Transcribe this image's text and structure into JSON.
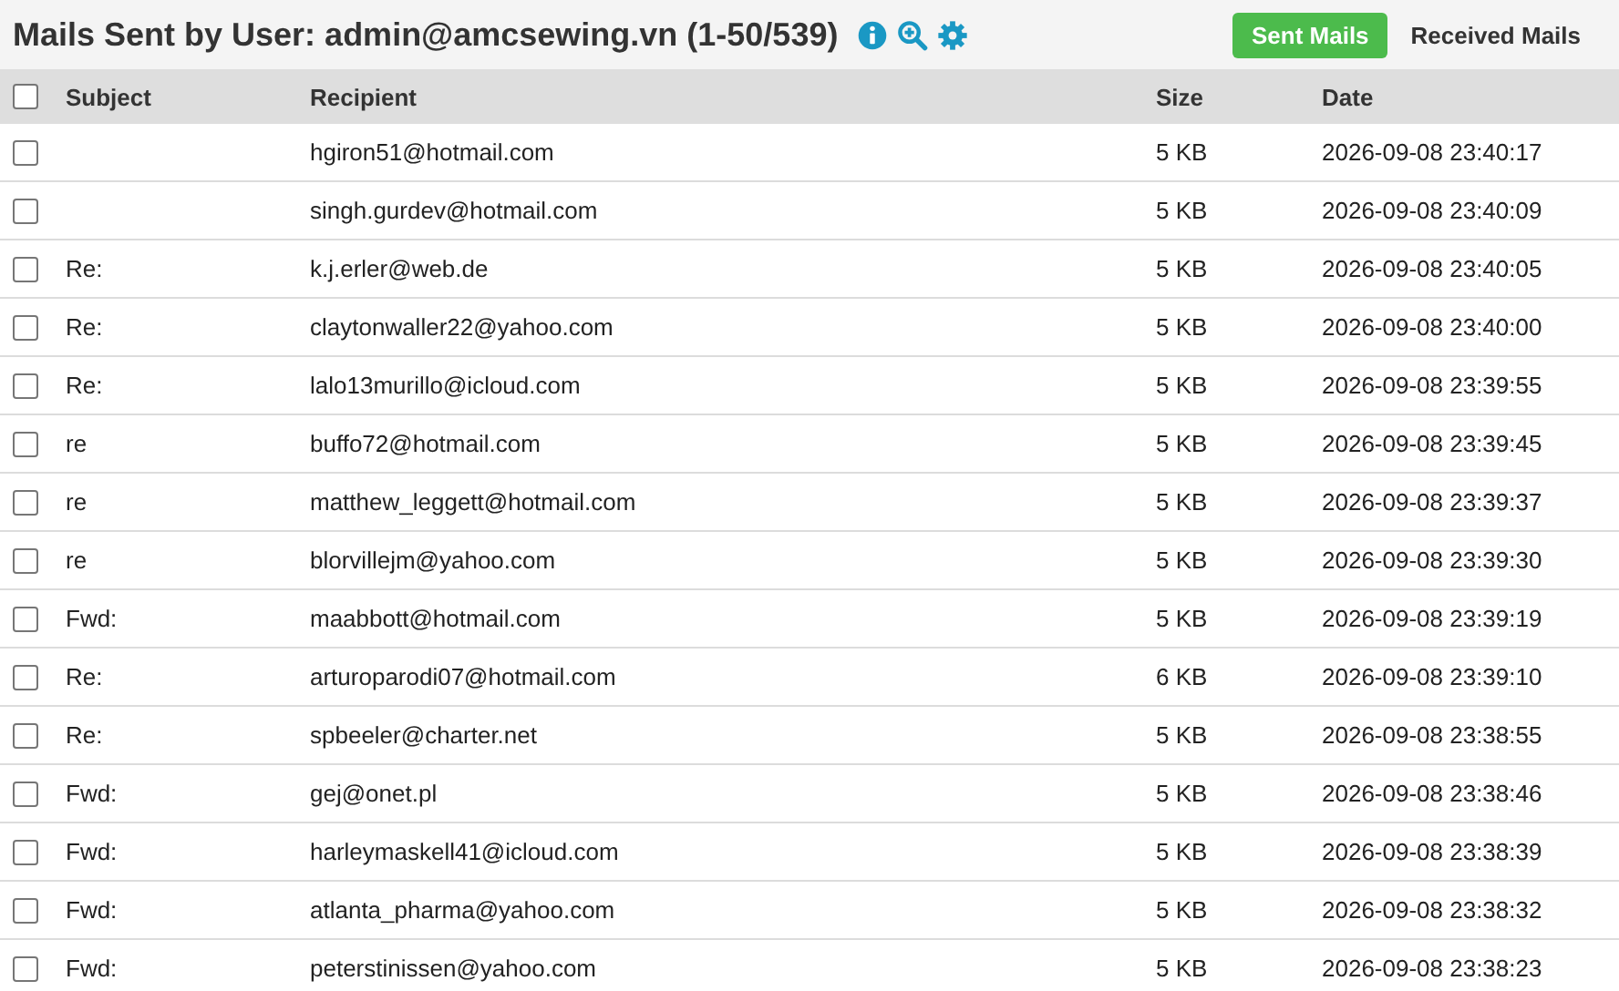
{
  "header": {
    "title": "Mails Sent by User: admin@amcsewing.vn (1-50/539)",
    "views": [
      {
        "label": "Sent Mails",
        "selected": true
      },
      {
        "label": "Received Mails",
        "selected": false
      }
    ]
  },
  "table": {
    "columns": [
      "Subject",
      "Recipient",
      "Size",
      "Date"
    ],
    "select_all": {
      "checked": false
    },
    "rows": [
      {
        "checked": false,
        "subject": "",
        "recipient": "hgiron51@hotmail.com",
        "size": "5 KB",
        "date": "2026-09-08 23:40:17"
      },
      {
        "checked": false,
        "subject": "",
        "recipient": "singh.gurdev@hotmail.com",
        "size": "5 KB",
        "date": "2026-09-08 23:40:09"
      },
      {
        "checked": false,
        "subject": "Re:",
        "recipient": "k.j.erler@web.de",
        "size": "5 KB",
        "date": "2026-09-08 23:40:05"
      },
      {
        "checked": false,
        "subject": "Re:",
        "recipient": "claytonwaller22@yahoo.com",
        "size": "5 KB",
        "date": "2026-09-08 23:40:00"
      },
      {
        "checked": false,
        "subject": "Re:",
        "recipient": "lalo13murillo@icloud.com",
        "size": "5 KB",
        "date": "2026-09-08 23:39:55"
      },
      {
        "checked": false,
        "subject": "re",
        "recipient": "buffo72@hotmail.com",
        "size": "5 KB",
        "date": "2026-09-08 23:39:45"
      },
      {
        "checked": false,
        "subject": "re",
        "recipient": "matthew_leggett@hotmail.com",
        "size": "5 KB",
        "date": "2026-09-08 23:39:37"
      },
      {
        "checked": false,
        "subject": "re",
        "recipient": "blorvillejm@yahoo.com",
        "size": "5 KB",
        "date": "2026-09-08 23:39:30"
      },
      {
        "checked": false,
        "subject": "Fwd:",
        "recipient": "maabbott@hotmail.com",
        "size": "5 KB",
        "date": "2026-09-08 23:39:19"
      },
      {
        "checked": false,
        "subject": "Re:",
        "recipient": "arturoparodi07@hotmail.com",
        "size": "6 KB",
        "date": "2026-09-08 23:39:10"
      },
      {
        "checked": false,
        "subject": "Re:",
        "recipient": "spbeeler@charter.net",
        "size": "5 KB",
        "date": "2026-09-08 23:38:55"
      },
      {
        "checked": false,
        "subject": "Fwd:",
        "recipient": "gej@onet.pl",
        "size": "5 KB",
        "date": "2026-09-08 23:38:46"
      },
      {
        "checked": false,
        "subject": "Fwd:",
        "recipient": "harleymaskell41@icloud.com",
        "size": "5 KB",
        "date": "2026-09-08 23:38:39"
      },
      {
        "checked": false,
        "subject": "Fwd:",
        "recipient": "atlanta_pharma@yahoo.com",
        "size": "5 KB",
        "date": "2026-09-08 23:38:32"
      },
      {
        "checked": false,
        "subject": "Fwd:",
        "recipient": "peterstinissen@yahoo.com",
        "size": "5 KB",
        "date": "2026-09-08 23:38:23"
      }
    ]
  }
}
